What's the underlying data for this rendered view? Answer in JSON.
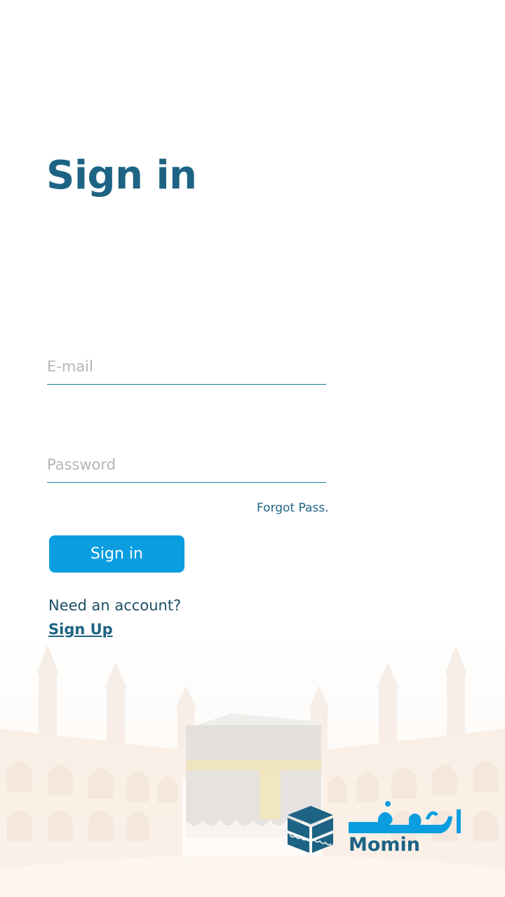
{
  "header": {
    "title": "Sign in"
  },
  "form": {
    "email_placeholder": "E-mail",
    "password_placeholder": "Password",
    "forgot_label": "Forgot Pass.",
    "signin_label": "Sign in"
  },
  "footer": {
    "need_account": "Need an account?",
    "signup_label": "Sign Up"
  },
  "brand": {
    "name": "Momin"
  },
  "colors": {
    "primary": "#1d6384",
    "accent": "#0a9ee0",
    "background": "#ffffff"
  }
}
